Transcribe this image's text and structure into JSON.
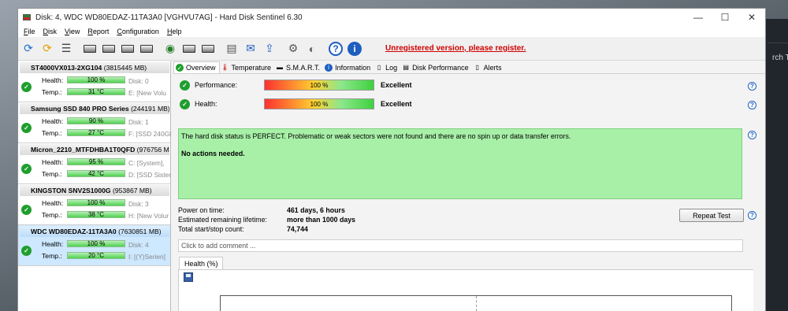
{
  "window": {
    "title": "Disk: 4, WDC WD80EDAZ-11TA3A0 [VGHVU7AG]  -  Hard Disk Sentinel 6.30",
    "minimize": "—",
    "maximize": "☐",
    "close": "✕"
  },
  "menu": [
    "File",
    "Disk",
    "View",
    "Report",
    "Configuration",
    "Help"
  ],
  "toolbar": {
    "unregistered": "Unregistered version, please register."
  },
  "disks": [
    {
      "name": "ST4000VX013-2XG104",
      "size": "(3815445 MB)",
      "health_label": "Health:",
      "health": "100 %",
      "health_value": 100,
      "temp_label": "Temp.:",
      "temp": "31 °C",
      "info1": "Disk: 0",
      "info2": "E: [New Volu"
    },
    {
      "name": "Samsung SSD 840 PRO Series",
      "size": "(244191 MB)",
      "health_label": "Health:",
      "health": "90 %",
      "health_value": 90,
      "temp_label": "Temp.:",
      "temp": "27 °C",
      "info1": "Disk: 1",
      "info2": "F: [SSD 240Gb"
    },
    {
      "name": "Micron_2210_MTFDHBA1T0QFD",
      "size": "(976756 M",
      "health_label": "Health:",
      "health": "95 %",
      "health_value": 95,
      "temp_label": "Temp.:",
      "temp": "42 °C",
      "info1": "C: [System],",
      "info2": "D: [SSD Sisten"
    },
    {
      "name": "KINGSTON SNV2S1000G",
      "size": "(953867 MB)",
      "health_label": "Health:",
      "health": "100 %",
      "health_value": 100,
      "temp_label": "Temp.:",
      "temp": "38 °C",
      "info1": "Disk: 3",
      "info2": "H: [New Volur"
    },
    {
      "name": "WDC WD80EDAZ-11TA3A0",
      "size": "(7630851 MB)",
      "health_label": "Health:",
      "health": "100 %",
      "health_value": 100,
      "temp_label": "Temp.:",
      "temp": "20 °C",
      "info1": "Disk: 4",
      "info2": "I: [(Y)Serien]"
    }
  ],
  "tabs": [
    "Overview",
    "Temperature",
    "S.M.A.R.T.",
    "Information",
    "Log",
    "Disk Performance",
    "Alerts"
  ],
  "overview": {
    "performance_label": "Performance:",
    "performance_value": "100 %",
    "performance_rating": "Excellent",
    "health_label": "Health:",
    "health_value": "100 %",
    "health_rating": "Excellent",
    "status_line1": "The hard disk status is PERFECT. Problematic or weak sectors were not found and there are no spin up or data transfer errors.",
    "status_line2": "No actions needed.",
    "power_on_label": "Power on time:",
    "power_on_value": "461 days, 6 hours",
    "lifetime_label": "Estimated remaining lifetime:",
    "lifetime_value": "more than 1000 days",
    "startstop_label": "Total start/stop count:",
    "startstop_value": "74,744",
    "repeat_button": "Repeat Test",
    "comment_placeholder": "Click to add comment ...",
    "chart_tab": "Health (%)"
  },
  "background": {
    "text": "rch Th"
  }
}
